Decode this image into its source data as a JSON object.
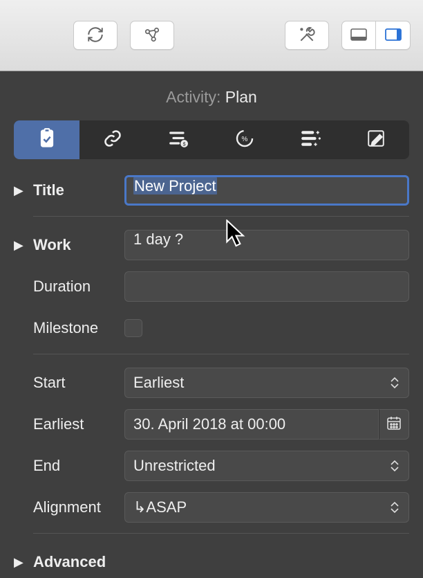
{
  "header": {
    "label": "Activity:",
    "value": "Plan"
  },
  "tabs": [
    "clipboard",
    "link",
    "cost",
    "progress",
    "list",
    "edit"
  ],
  "fields": {
    "title_label": "Title",
    "title_value": "New Project",
    "work_label": "Work",
    "work_value": "1 day ?",
    "duration_label": "Duration",
    "duration_value": "",
    "milestone_label": "Milestone",
    "milestone_checked": false,
    "start_label": "Start",
    "start_value": "Earliest",
    "earliest_label": "Earliest",
    "earliest_value": "30. April 2018 at 00:00",
    "end_label": "End",
    "end_value": "Unrestricted",
    "alignment_label": "Alignment",
    "alignment_value": "↳ASAP",
    "advanced_label": "Advanced"
  }
}
